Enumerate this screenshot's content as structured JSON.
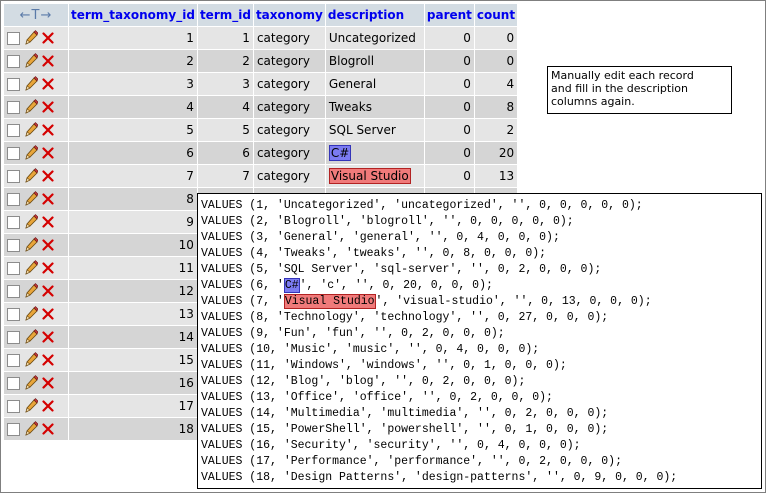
{
  "headers": {
    "arrows": "←T→",
    "term_taxonomy_id": "term_taxonomy_id",
    "term_id": "term_id",
    "taxonomy": "taxonomy",
    "description": "description",
    "parent": "parent",
    "count": "count"
  },
  "rows": [
    {
      "id": "1",
      "term": "1",
      "tax": "category",
      "desc": "Uncategorized",
      "parent": "0",
      "count": "0"
    },
    {
      "id": "2",
      "term": "2",
      "tax": "category",
      "desc": "Blogroll",
      "parent": "0",
      "count": "0"
    },
    {
      "id": "3",
      "term": "3",
      "tax": "category",
      "desc": "General",
      "parent": "0",
      "count": "4"
    },
    {
      "id": "4",
      "term": "4",
      "tax": "category",
      "desc": "Tweaks",
      "parent": "0",
      "count": "8"
    },
    {
      "id": "5",
      "term": "5",
      "tax": "category",
      "desc": "SQL Server",
      "parent": "0",
      "count": "2"
    },
    {
      "id": "6",
      "term": "6",
      "tax": "category",
      "desc": "C#",
      "parent": "0",
      "count": "20"
    },
    {
      "id": "7",
      "term": "7",
      "tax": "category",
      "desc": "Visual Studio",
      "parent": "0",
      "count": "13"
    },
    {
      "id": "8"
    },
    {
      "id": "9"
    },
    {
      "id": "10"
    },
    {
      "id": "11"
    },
    {
      "id": "12"
    },
    {
      "id": "13"
    },
    {
      "id": "14"
    },
    {
      "id": "15"
    },
    {
      "id": "16"
    },
    {
      "id": "17"
    },
    {
      "id": "18"
    }
  ],
  "note": "Manually edit each record\nand fill in the description\ncolumns again.",
  "sql": {
    "l1": "VALUES (1, 'Uncategorized', 'uncategorized', '', 0, 0, 0, 0, 0);",
    "l2": "VALUES (2, 'Blogroll', 'blogroll', '', 0, 0, 0, 0, 0);",
    "l3": "VALUES (3, 'General', 'general', '', 0, 4, 0, 0, 0);",
    "l4": "VALUES (4, 'Tweaks', 'tweaks', '', 0, 8, 0, 0, 0);",
    "l5": "VALUES (5, 'SQL Server', 'sql-server', '', 0, 2, 0, 0, 0);",
    "l6a": "VALUES (6, '",
    "l6b": "C#",
    "l6c": "', 'c', '', 0, 20, 0, 0, 0);",
    "l7a": "VALUES (7, '",
    "l7b": "Visual Studio",
    "l7c": "', 'visual-studio', '', 0, 13, 0, 0, 0);",
    "l8": "VALUES (8, 'Technology', 'technology', '', 0, 27, 0, 0, 0);",
    "l9": "VALUES (9, 'Fun', 'fun', '', 0, 2, 0, 0, 0);",
    "l10": "VALUES (10, 'Music', 'music', '', 0, 4, 0, 0, 0);",
    "l11": "VALUES (11, 'Windows', 'windows', '', 0, 1, 0, 0, 0);",
    "l12": "VALUES (12, 'Blog', 'blog', '', 0, 2, 0, 0, 0);",
    "l13": "VALUES (13, 'Office', 'office', '', 0, 2, 0, 0, 0);",
    "l14": "VALUES (14, 'Multimedia', 'multimedia', '', 0, 2, 0, 0, 0);",
    "l15": "VALUES (15, 'PowerShell', 'powershell', '', 0, 1, 0, 0, 0);",
    "l16": "VALUES (16, 'Security', 'security', '', 0, 4, 0, 0, 0);",
    "l17": "VALUES (17, 'Performance', 'performance', '', 0, 2, 0, 0, 0);",
    "l18": "VALUES (18, 'Design Patterns', 'design-patterns', '', 0, 9, 0, 0, 0);"
  },
  "colors": {
    "header_bg": "#d3dce3",
    "row_light": "#e5e5e5",
    "row_dark": "#d5d5d5",
    "highlight_blue": "#7b7bf2",
    "highlight_red": "#f07a7a"
  }
}
